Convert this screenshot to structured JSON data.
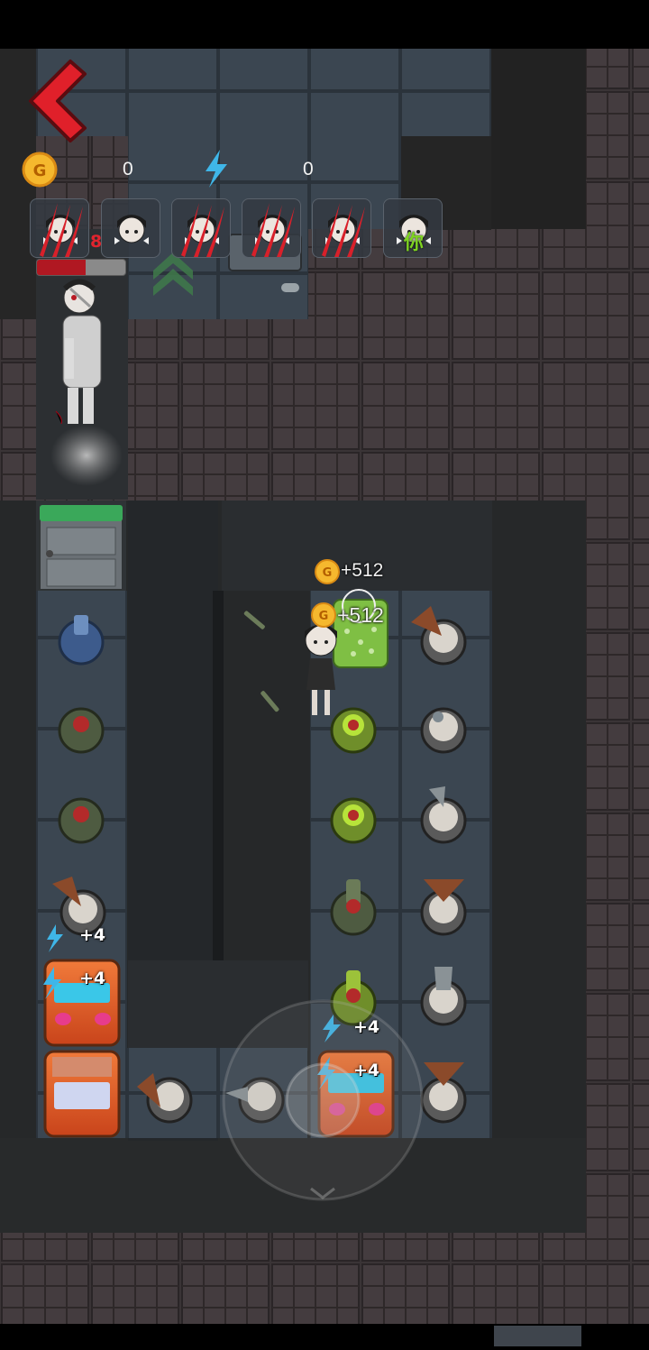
{
  "hud": {
    "coin_count": "0",
    "energy_count": "0",
    "back_icon": "chevron-left-icon",
    "coin_icon": "gold-coin-icon",
    "energy_icon": "lightning-icon"
  },
  "players": [
    {
      "state": "clawed"
    },
    {
      "state": "alive"
    },
    {
      "state": "clawed"
    },
    {
      "state": "clawed"
    },
    {
      "state": "clawed"
    },
    {
      "state": "alive",
      "label": "你"
    }
  ],
  "enemy": {
    "hp_value": "8",
    "hp_fraction": 0.55
  },
  "rewards": {
    "coin_gain_1": "+512",
    "coin_gain_2": "+512"
  },
  "badges": {
    "b1": "+4",
    "b2": "+4",
    "b3": "+4",
    "b4": "+4"
  },
  "colors": {
    "hp_fill": "#b01822",
    "you_label": "#7ed321",
    "back_arrow": "#e0202a",
    "energy": "#3fb6e8",
    "coin": "#f5b82e"
  }
}
